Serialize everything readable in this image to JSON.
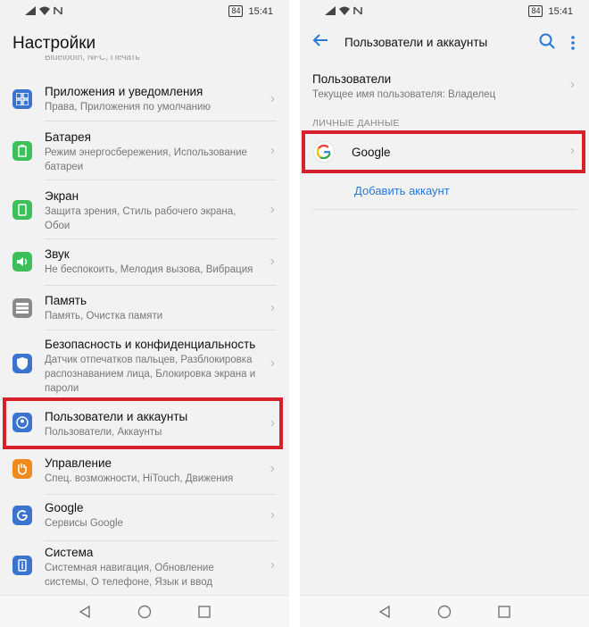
{
  "status": {
    "battery": "84",
    "time": "15:41"
  },
  "left": {
    "title": "Настройки",
    "partial_text": "Bluetooth, NFC, Печать",
    "items": [
      {
        "title": "Приложения и уведомления",
        "sub": "Права, Приложения по умолчанию",
        "color": "#3b74cf",
        "icon": "apps-icon"
      },
      {
        "title": "Батарея",
        "sub": "Режим энергосбережения, Использование батареи",
        "color": "#3dbf5a",
        "icon": "battery-icon"
      },
      {
        "title": "Экран",
        "sub": "Защита зрения, Стиль рабочего экрана, Обои",
        "color": "#3dbf5a",
        "icon": "display-icon"
      },
      {
        "title": "Звук",
        "sub": "Не беспокоить, Мелодия вызова, Вибрация",
        "color": "#3dbf5a",
        "icon": "sound-icon"
      },
      {
        "title": "Память",
        "sub": "Память, Очистка памяти",
        "color": "#8a8a8a",
        "icon": "memory-icon"
      },
      {
        "title": "Безопасность и конфиденциальность",
        "sub": "Датчик отпечатков пальцев, Разблокировка распознаванием лица, Блокировка экрана и пароли",
        "color": "#3b74cf",
        "icon": "shield-icon"
      },
      {
        "title": "Пользователи и аккаунты",
        "sub": "Пользователи, Аккаунты",
        "color": "#3b74cf",
        "icon": "user-icon"
      },
      {
        "title": "Управление",
        "sub": "Спец. возможности, HiTouch, Движения",
        "color": "#f08a1e",
        "icon": "hand-icon"
      },
      {
        "title": "Google",
        "sub": "Сервисы Google",
        "color": "#3b74cf",
        "icon": "google-g-icon"
      },
      {
        "title": "Система",
        "sub": "Системная навигация, Обновление системы, О телефоне, Язык и ввод",
        "color": "#3b74cf",
        "icon": "info-icon"
      }
    ]
  },
  "right": {
    "title": "Пользователи и аккаунты",
    "users": {
      "title": "Пользователи",
      "sub": "Текущее имя пользователя: Владелец"
    },
    "section": "ЛИЧНЫЕ ДАННЫЕ",
    "google": "Google",
    "add_account": "Добавить аккаунт"
  }
}
